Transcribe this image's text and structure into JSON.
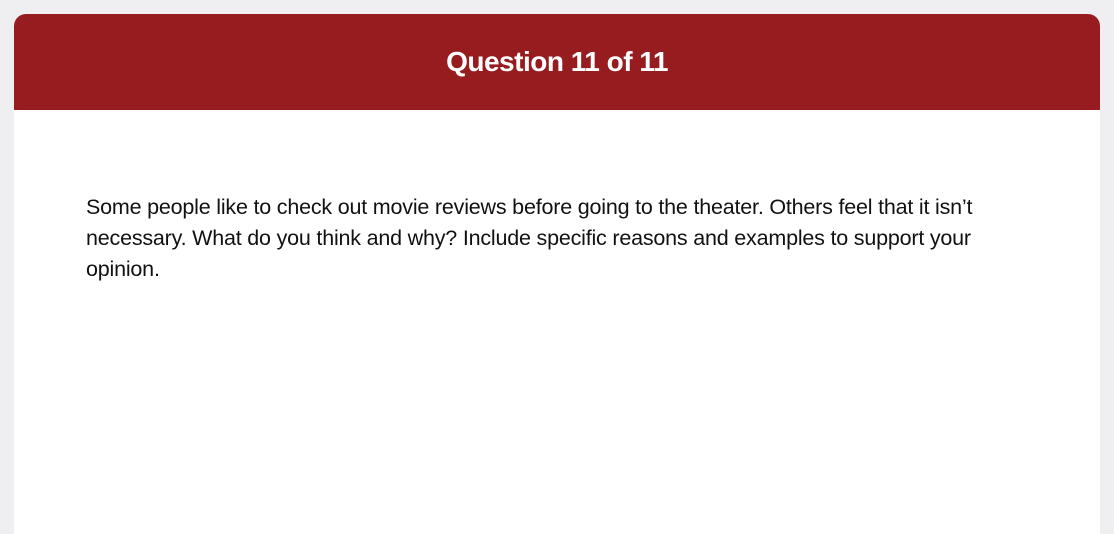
{
  "colors": {
    "header_background": "#961c20",
    "header_text": "#ffffff",
    "page_background": "#efeff2",
    "card_background": "#ffffff",
    "body_text": "#111111"
  },
  "header": {
    "title": "Question 11 of 11"
  },
  "question": {
    "prompt": "Some people like to check out movie reviews before going to the theater. Others feel that it isn’t necessary. What do you think and why? Include specific reasons and examples to support your opinion."
  }
}
